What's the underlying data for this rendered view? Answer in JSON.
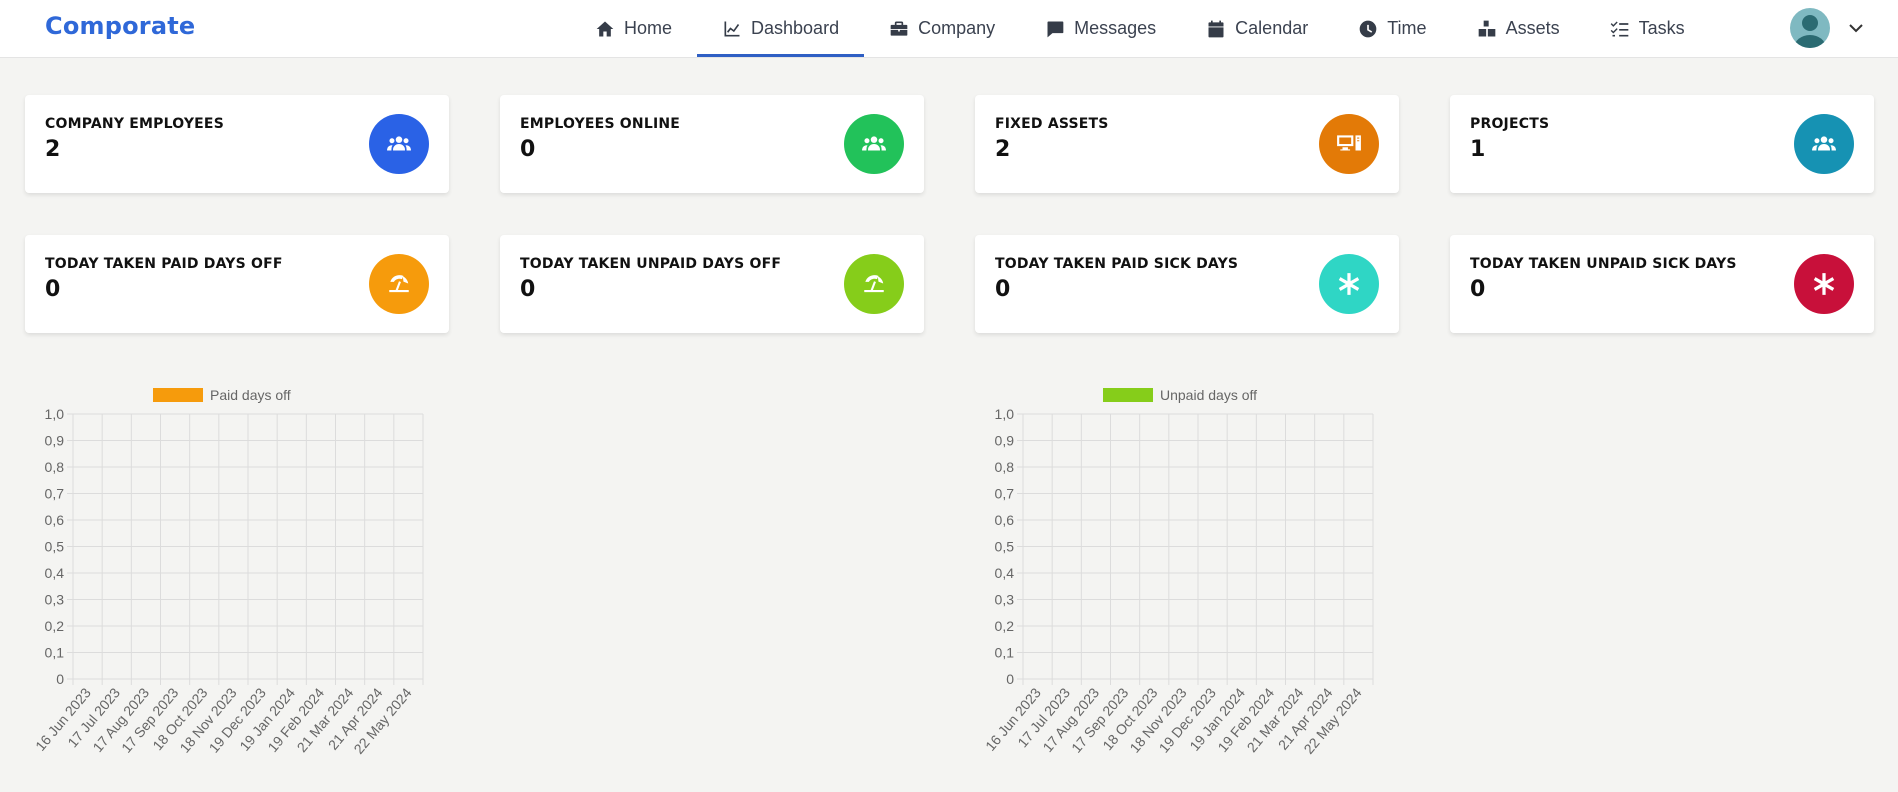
{
  "brand": "Comporate",
  "nav": [
    {
      "label": "Home",
      "icon": "home-icon"
    },
    {
      "label": "Dashboard",
      "icon": "chart-line-icon",
      "active": true
    },
    {
      "label": "Company",
      "icon": "briefcase-icon"
    },
    {
      "label": "Messages",
      "icon": "message-icon"
    },
    {
      "label": "Calendar",
      "icon": "calendar-icon"
    },
    {
      "label": "Time",
      "icon": "clock-icon"
    },
    {
      "label": "Assets",
      "icon": "boxes-icon"
    },
    {
      "label": "Tasks",
      "icon": "task-list-icon"
    }
  ],
  "user_menu": {
    "avatar_icon": "user-avatar-icon",
    "toggle_icon": "chevron-down-icon"
  },
  "stats": [
    {
      "title": "COMPANY EMPLOYEES",
      "value": "2",
      "color": "#2a62e6",
      "icon": "users-icon"
    },
    {
      "title": "EMPLOYEES ONLINE",
      "value": "0",
      "color": "#22c25a",
      "icon": "users-icon"
    },
    {
      "title": "FIXED ASSETS",
      "value": "2",
      "color": "#e37a07",
      "icon": "computer-icon"
    },
    {
      "title": "PROJECTS",
      "value": "1",
      "color": "#1692b3",
      "icon": "users-icon"
    },
    {
      "title": "TODAY TAKEN PAID DAYS OFF",
      "value": "0",
      "color": "#f69b0c",
      "icon": "umbrella-beach-icon"
    },
    {
      "title": "TODAY TAKEN UNPAID DAYS OFF",
      "value": "0",
      "color": "#86cd1a",
      "icon": "umbrella-beach-icon"
    },
    {
      "title": "TODAY TAKEN PAID SICK DAYS",
      "value": "0",
      "color": "#2fd6c5",
      "icon": "asterisk-icon"
    },
    {
      "title": "TODAY TAKEN UNPAID SICK DAYS",
      "value": "0",
      "color": "#c8103a",
      "icon": "asterisk-icon"
    }
  ],
  "chart_data": [
    {
      "type": "bar",
      "categories": [
        "16 Jun 2023",
        "17 Jul 2023",
        "17 Aug 2023",
        "17 Sep 2023",
        "18 Oct 2023",
        "18 Nov 2023",
        "19 Dec 2023",
        "19 Jan 2024",
        "19 Feb 2024",
        "21 Mar 2024",
        "21 Apr 2024",
        "22 May 2024"
      ],
      "series": [
        {
          "name": "Paid days off",
          "values": [
            0,
            0,
            0,
            0,
            0,
            0,
            0,
            0,
            0,
            0,
            0,
            0
          ],
          "color": "#f69b0c"
        }
      ],
      "ylim": [
        0,
        1
      ],
      "yticks": [
        "1,0",
        "0,9",
        "0,8",
        "0,7",
        "0,6",
        "0,5",
        "0,4",
        "0,3",
        "0,2",
        "0,1",
        "0"
      ],
      "grid": true,
      "legend": "top"
    },
    {
      "type": "bar",
      "categories": [
        "16 Jun 2023",
        "17 Jul 2023",
        "17 Aug 2023",
        "17 Sep 2023",
        "18 Oct 2023",
        "18 Nov 2023",
        "19 Dec 2023",
        "19 Jan 2024",
        "19 Feb 2024",
        "21 Mar 2024",
        "21 Apr 2024",
        "22 May 2024"
      ],
      "series": [
        {
          "name": "Unpaid days off",
          "values": [
            0,
            0,
            0,
            0,
            0,
            0,
            0,
            0,
            0,
            0,
            0,
            0
          ],
          "color": "#86cd1a"
        }
      ],
      "ylim": [
        0,
        1
      ],
      "yticks": [
        "1,0",
        "0,9",
        "0,8",
        "0,7",
        "0,6",
        "0,5",
        "0,4",
        "0,3",
        "0,2",
        "0,1",
        "0"
      ],
      "grid": true,
      "legend": "top"
    }
  ]
}
